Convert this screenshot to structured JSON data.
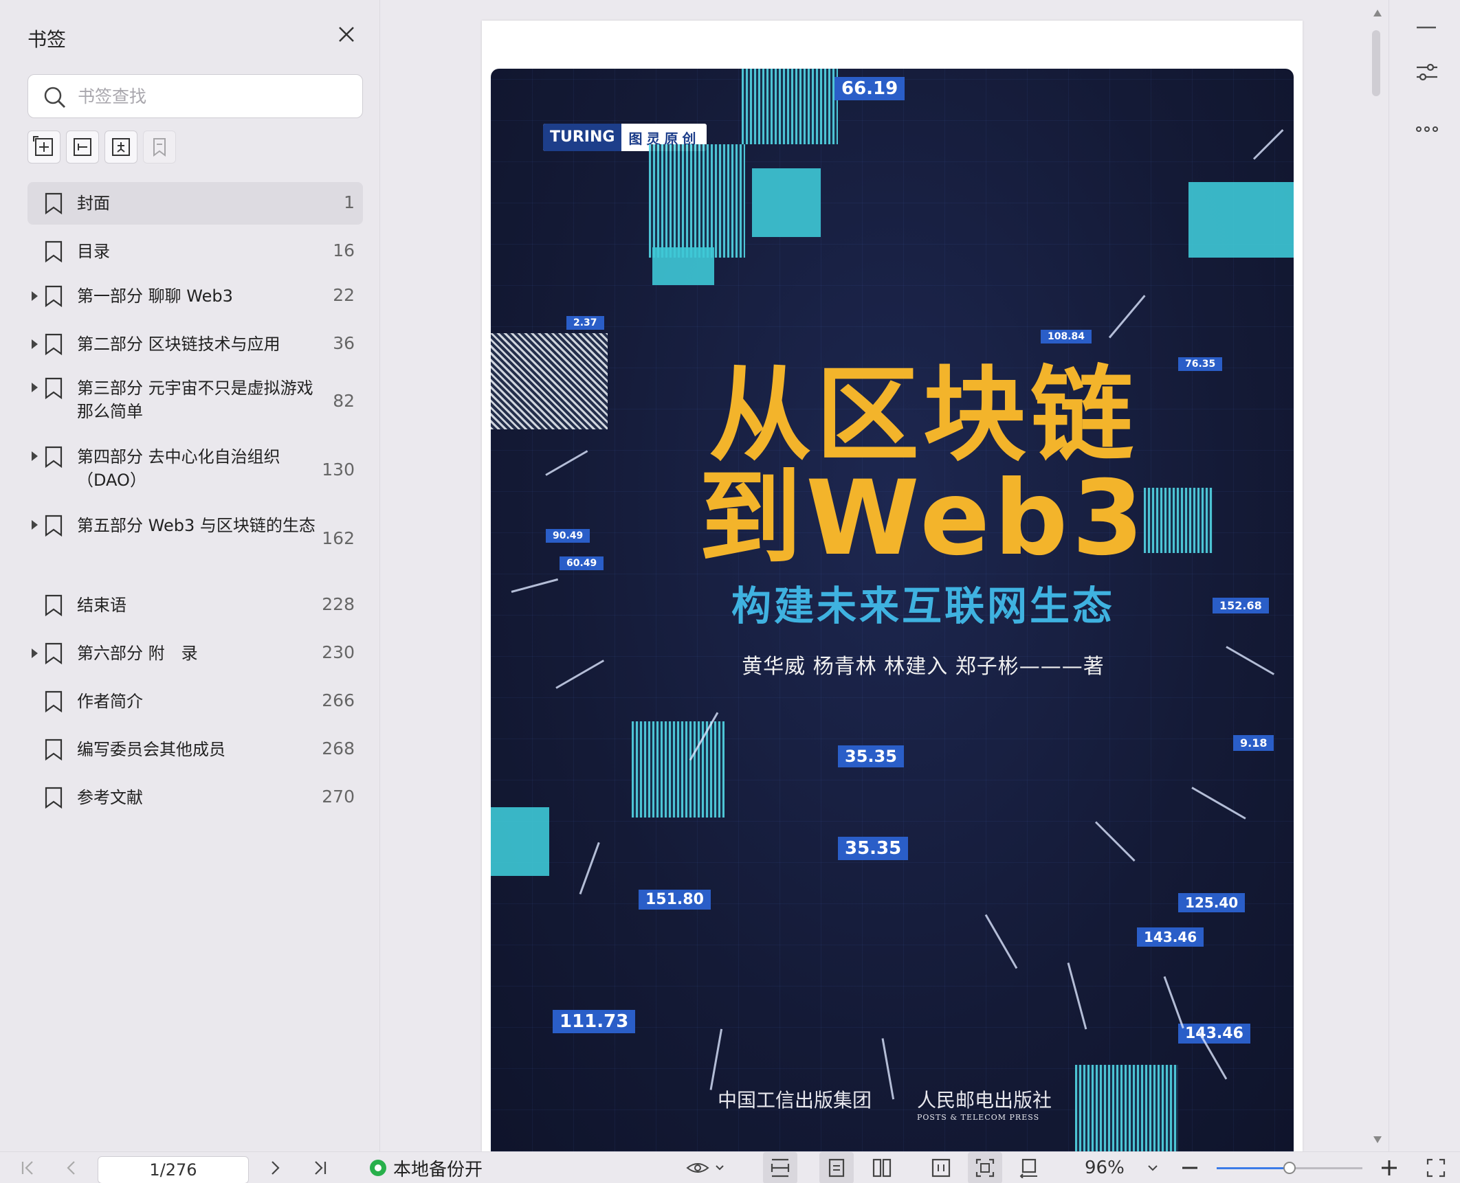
{
  "sidebar": {
    "title": "书签",
    "search_placeholder": "书签查找",
    "tools": [
      "add-bookmark-icon",
      "add-sub-bookmark-icon",
      "insert-bookmark-icon",
      "bookmark-disabled-icon"
    ],
    "items": [
      {
        "label": "封面",
        "page": "1",
        "expandable": false,
        "selected": true
      },
      {
        "label": "目录",
        "page": "16",
        "expandable": false,
        "selected": false
      },
      {
        "label": "第一部分 聊聊 Web3",
        "page": "22",
        "expandable": true,
        "selected": false
      },
      {
        "label": "第二部分 区块链技术与应用",
        "page": "36",
        "expandable": true,
        "selected": false
      },
      {
        "label": "第三部分 元宇宙不只是虚拟游戏那么简单",
        "page": "82",
        "expandable": true,
        "selected": false
      },
      {
        "label": "第四部分 去中心化自治组织（DAO）",
        "page": "130",
        "expandable": true,
        "selected": false
      },
      {
        "label": "第五部分 Web3 与区块链的生态",
        "page": "162",
        "expandable": true,
        "selected": false
      },
      {
        "label": "结束语",
        "page": "228",
        "expandable": false,
        "selected": false
      },
      {
        "label": "第六部分 附　录",
        "page": "230",
        "expandable": true,
        "selected": false
      },
      {
        "label": "作者简介",
        "page": "266",
        "expandable": false,
        "selected": false
      },
      {
        "label": "编写委员会其他成员",
        "page": "268",
        "expandable": false,
        "selected": false
      },
      {
        "label": "参考文献",
        "page": "270",
        "expandable": false,
        "selected": false
      }
    ]
  },
  "cover": {
    "badge_en": "TURING",
    "badge_cn": "图灵原创",
    "title_line1": "从区块链",
    "title_line2": "到Web3",
    "subtitle": "构建未来互联网生态",
    "authors": "黄华威  杨青林  林建入  郑子彬———著",
    "publisher1": "中国工信出版集团",
    "publisher2": "人民邮电出版社",
    "publisher2_en": "POSTS & TELECOM PRESS",
    "tags": [
      "66.19",
      "35.35",
      "35.35",
      "151.80",
      "125.40",
      "143.46",
      "111.73",
      "143.46",
      "152.68",
      "9.18",
      "2.37",
      "90.49",
      "60.49",
      "76.35",
      "108.84"
    ],
    "accent_color": "#f3b42b",
    "sub_color": "#3fb2e0"
  },
  "bottombar": {
    "page_indicator": "1/276",
    "backup_label": "本地备份开",
    "zoom_label": "96%",
    "zoom_percent": 96
  },
  "colors": {
    "accent": "#3b7be8",
    "backup_on": "#28b04b"
  }
}
